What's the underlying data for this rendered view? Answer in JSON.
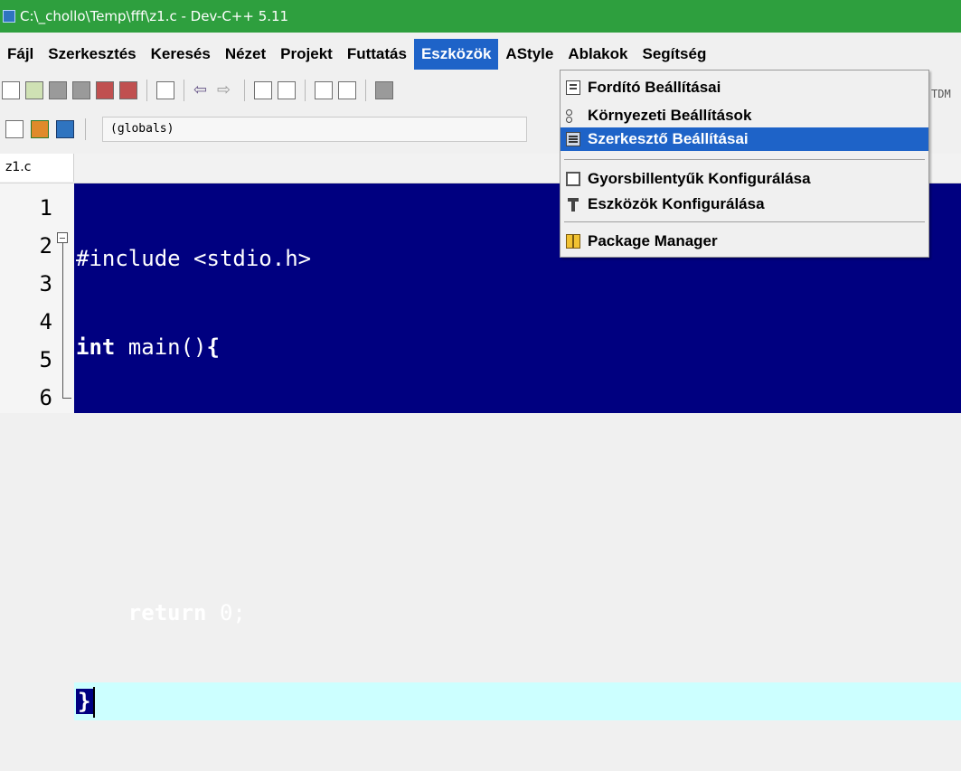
{
  "window": {
    "title": "C:\\_chollo\\Temp\\fff\\z1.c - Dev-C++ 5.11"
  },
  "menubar": {
    "items": [
      "Fájl",
      "Szerkesztés",
      "Keresés",
      "Nézet",
      "Projekt",
      "Futtatás",
      "Eszközök",
      "AStyle",
      "Ablakok",
      "Segítség"
    ],
    "active": "Eszközök"
  },
  "toolbar": {
    "scope_combo": "(globals)",
    "truncated_combo_text": "TDM"
  },
  "tabs": [
    {
      "label": "z1.c"
    }
  ],
  "editor": {
    "line_numbers": [
      "1",
      "2",
      "3",
      "4",
      "5",
      "6"
    ],
    "lines": {
      "l1": "#include <stdio.h>",
      "l2_kw": "int",
      "l2_rest": " main()",
      "l2_brace": "{",
      "l5_indent": "    ",
      "l5_kw": "return",
      "l5_rest": " 0;",
      "l6_brace": "}"
    },
    "colors": {
      "selection": "#000080",
      "current_line": "#ccffff"
    }
  },
  "dropdown": {
    "items": [
      {
        "label": "Fordító Beállításai",
        "icon": "compiler-options-icon"
      },
      {
        "label": "Környezeti Beállítások",
        "icon": "environment-options-icon"
      },
      {
        "label": "Szerkesztő Beállításai",
        "icon": "editor-options-icon",
        "selected": true
      },
      {
        "label": "Gyorsbillentyűk Konfigurálása",
        "icon": "shortcuts-icon"
      },
      {
        "label": "Eszközök Konfigurálása",
        "icon": "tools-icon"
      },
      {
        "label": "Package Manager",
        "icon": "package-icon"
      }
    ]
  },
  "colors": {
    "titlebar": "#2e9f3e",
    "menu_highlight": "#1e63c8"
  }
}
